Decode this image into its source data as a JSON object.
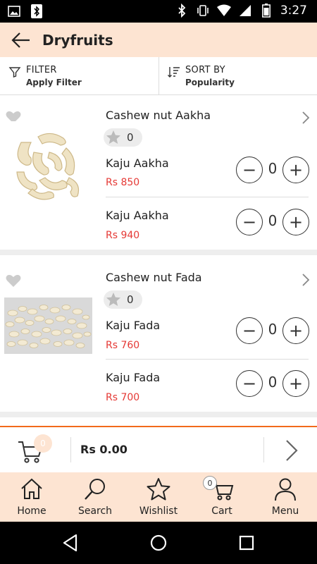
{
  "status_bar": {
    "time": "3:27",
    "left_icons": [
      "image-icon",
      "bluetooth-icon"
    ],
    "right_icons": [
      "bluetooth-icon",
      "vibrate-icon",
      "wifi-icon",
      "signal-icon",
      "battery-icon"
    ]
  },
  "app_bar": {
    "title": "Dryfruits",
    "back_icon": "arrow-left-icon"
  },
  "filter_bar": {
    "filter_label": "FILTER",
    "filter_value": "Apply Filter",
    "sort_label": "SORT BY",
    "sort_value": "Popularity"
  },
  "products": [
    {
      "name": "Cashew nut Aakha",
      "rating": "0",
      "image": "whole-cashews",
      "variants": [
        {
          "name": "Kaju Aakha",
          "price": "Rs 850",
          "qty": "0"
        },
        {
          "name": "Kaju Aakha",
          "price": "Rs 940",
          "qty": "0"
        }
      ]
    },
    {
      "name": "Cashew nut Fada",
      "rating": "0",
      "image": "broken-cashews",
      "variants": [
        {
          "name": "Kaju Fada",
          "price": "Rs 760",
          "qty": "0"
        },
        {
          "name": "Kaju Fada",
          "price": "Rs 700",
          "qty": "0"
        }
      ]
    }
  ],
  "cart_bar": {
    "badge": "0",
    "total": "Rs 0.00"
  },
  "bottom_nav": [
    {
      "label": "Home",
      "icon": "home-icon"
    },
    {
      "label": "Search",
      "icon": "search-icon"
    },
    {
      "label": "Wishlist",
      "icon": "star-icon"
    },
    {
      "label": "Cart",
      "icon": "cart-icon",
      "badge": "0"
    },
    {
      "label": "Menu",
      "icon": "user-icon"
    }
  ],
  "colors": {
    "accent": "#f26a1b",
    "header_bg": "#fde4d2",
    "price": "#e53935"
  }
}
